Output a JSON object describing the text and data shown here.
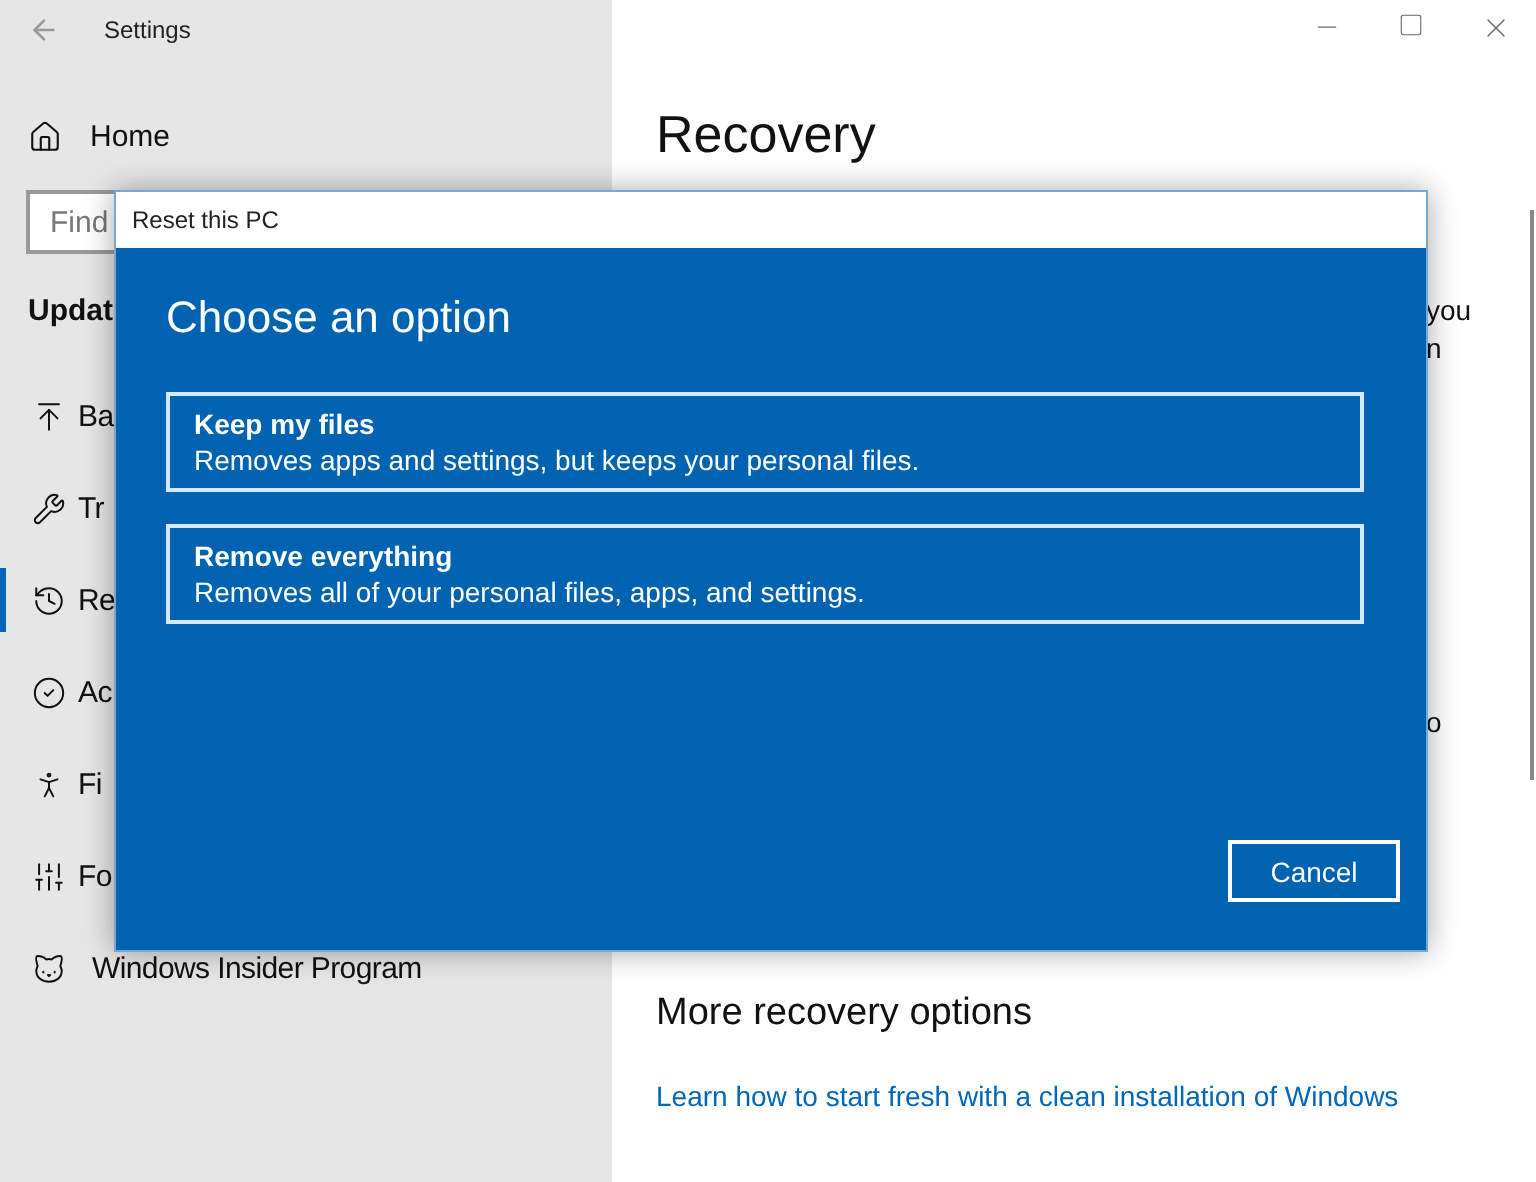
{
  "window": {
    "title": "Settings"
  },
  "sidebar": {
    "home": "Home",
    "search": {
      "placeholder": "Find"
    },
    "section": "Updat",
    "items": [
      {
        "label": "Ba",
        "selected": false
      },
      {
        "label": "Tr",
        "selected": false
      },
      {
        "label": "Re",
        "selected": true
      },
      {
        "label": "Ac",
        "selected": false
      },
      {
        "label": "Fi",
        "selected": false
      },
      {
        "label": "Fo",
        "selected": false
      },
      {
        "label": "Windows Insider Program",
        "selected": false
      }
    ]
  },
  "main": {
    "title": "Recovery",
    "fragments": [
      "you",
      "n",
      "o"
    ],
    "section": "More recovery options",
    "link": "Learn how to start fresh with a clean installation of Windows"
  },
  "dialog": {
    "title": "Reset this PC",
    "heading": "Choose an option",
    "options": [
      {
        "title": "Keep my files",
        "description": "Removes apps and settings, but keeps your personal files."
      },
      {
        "title": "Remove everything",
        "description": "Removes all of your personal files, apps, and settings."
      }
    ],
    "button": "Cancel"
  }
}
